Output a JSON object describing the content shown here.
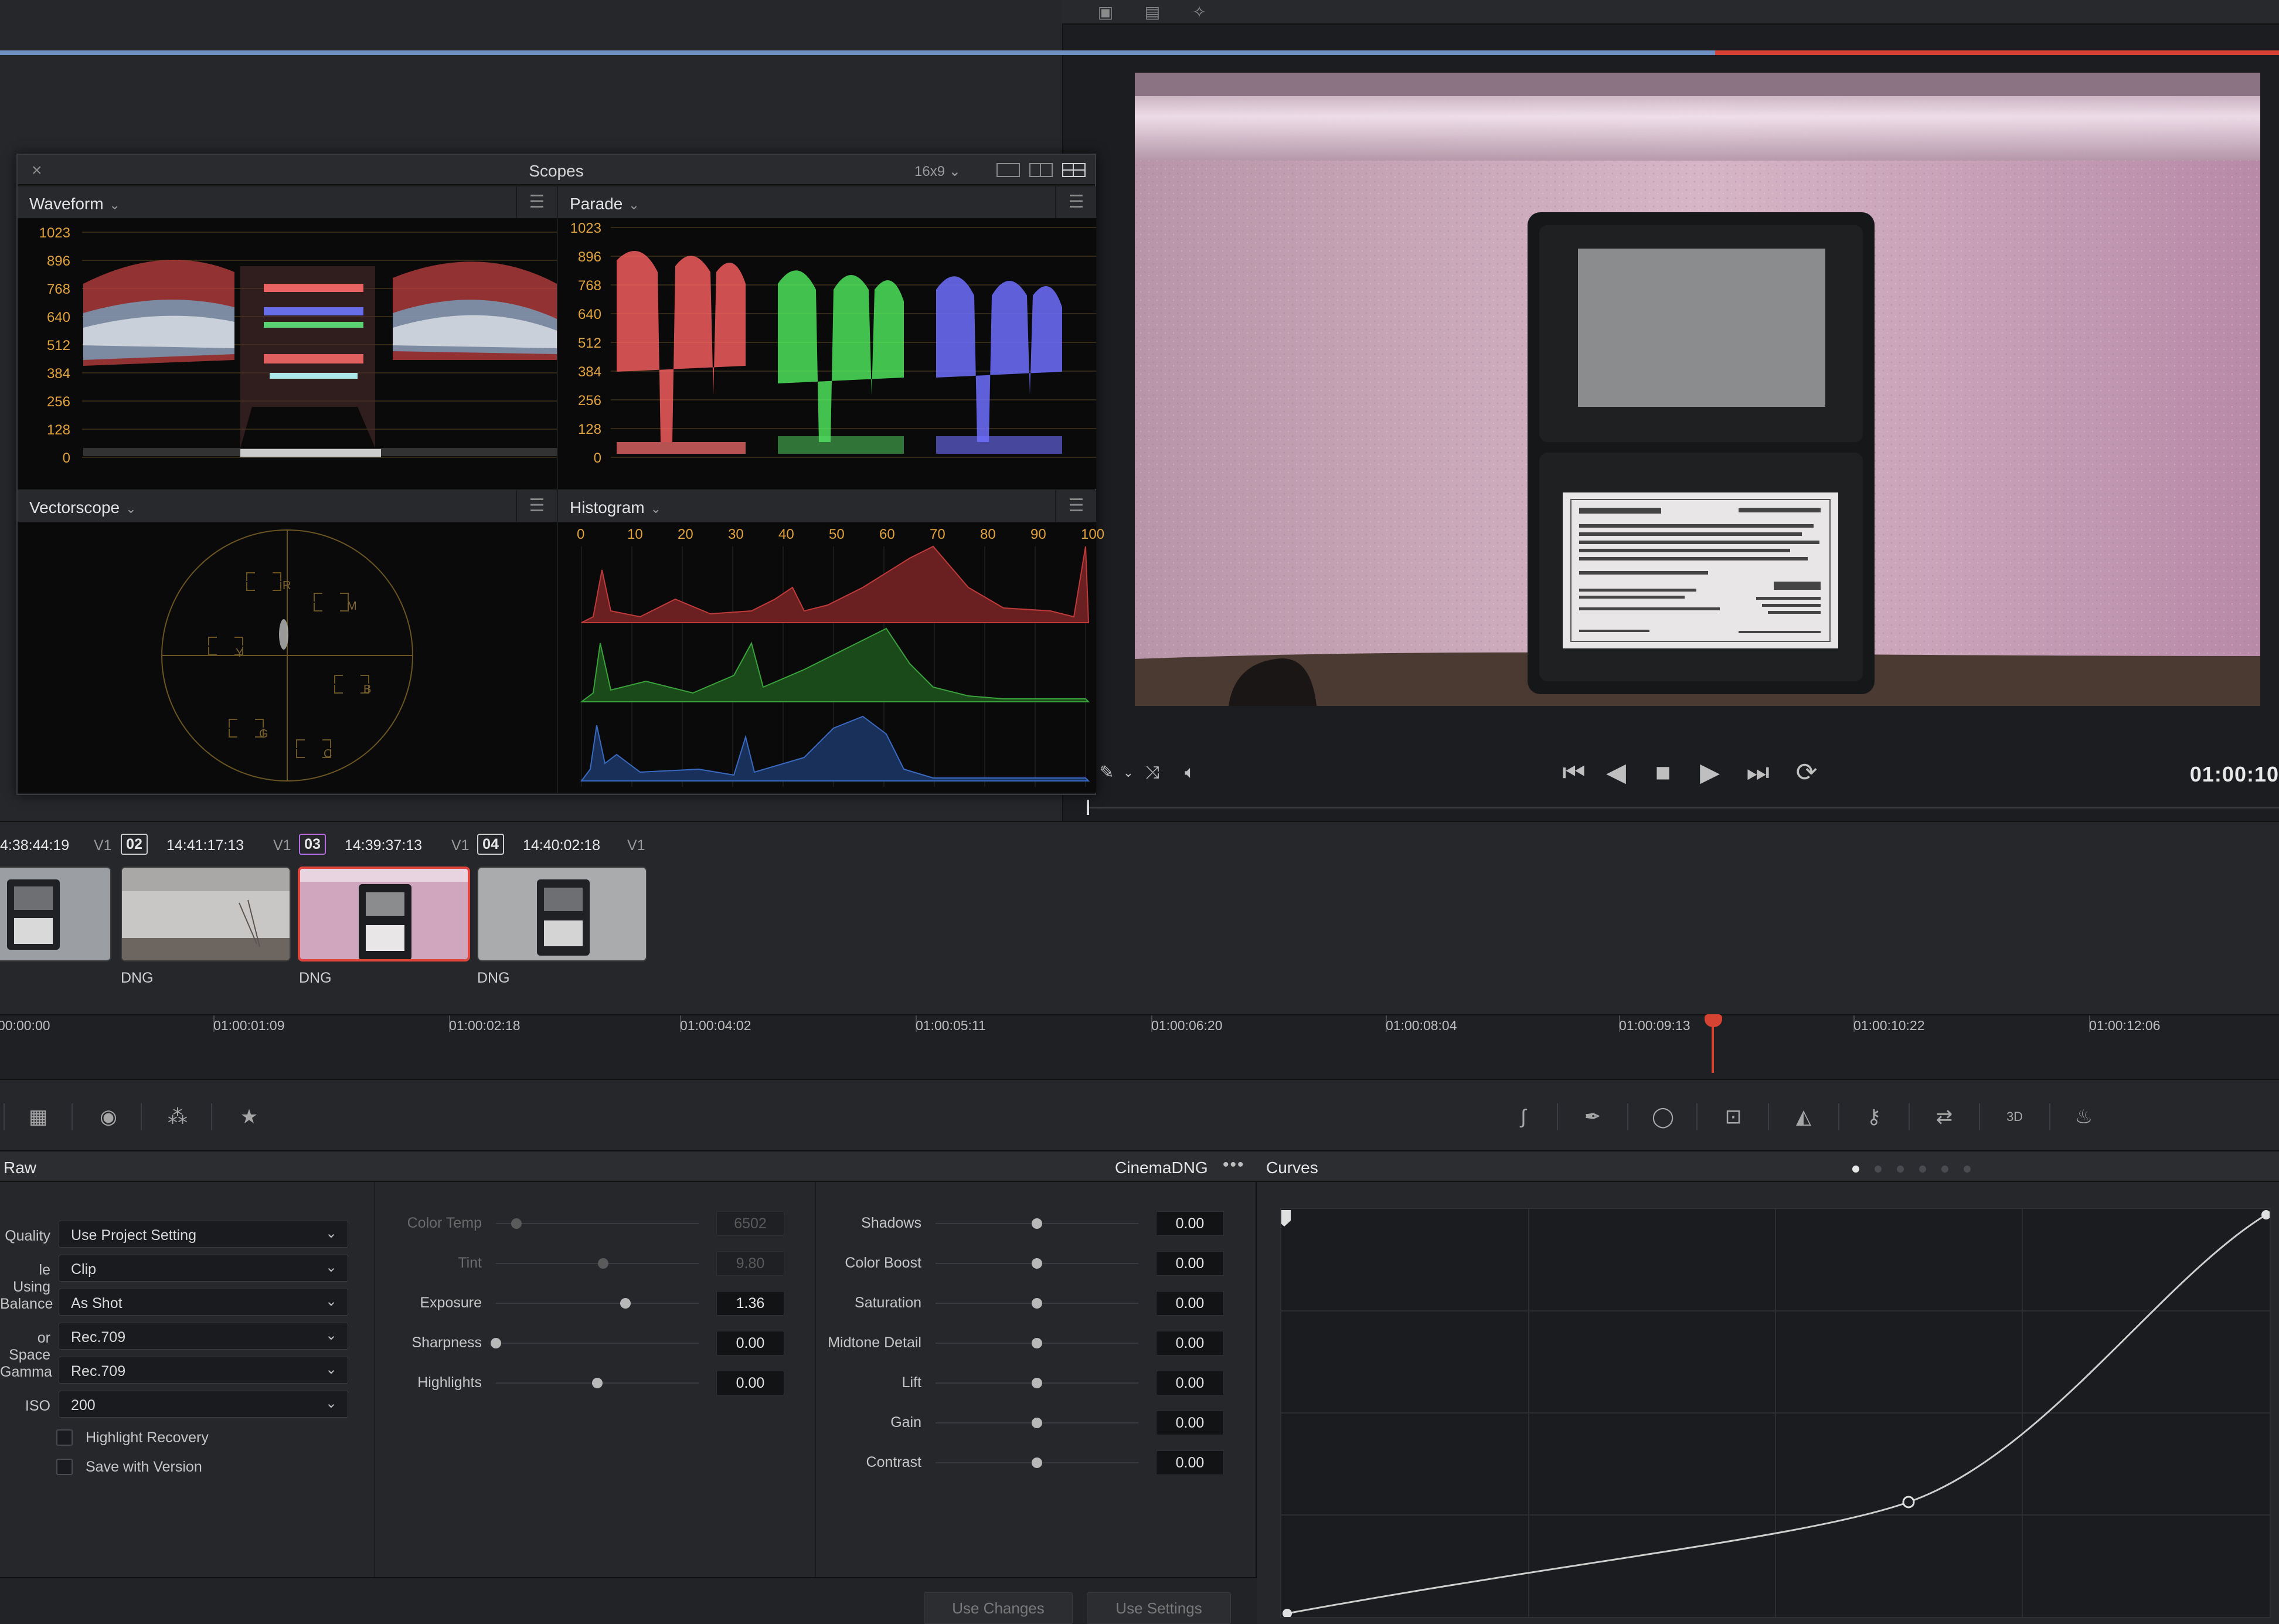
{
  "viewer": {
    "timecode": "01:00:10",
    "toolbar_icons": [
      "single-view-icon",
      "split-view-icon",
      "magic-wand-icon"
    ]
  },
  "scopes": {
    "title": "Scopes",
    "aspect": "16x9",
    "waveform": {
      "name": "Waveform",
      "y_ticks": [
        "1023",
        "896",
        "768",
        "640",
        "512",
        "384",
        "256",
        "128",
        "0"
      ]
    },
    "parade": {
      "name": "Parade",
      "y_ticks": [
        "1023",
        "896",
        "768",
        "640",
        "512",
        "384",
        "256",
        "128",
        "0"
      ]
    },
    "vectorscope": {
      "name": "Vectorscope",
      "targets": [
        "R",
        "M",
        "Y",
        "B",
        "G",
        "C"
      ]
    },
    "histogram": {
      "name": "Histogram",
      "x_ticks": [
        "0",
        "10",
        "20",
        "30",
        "40",
        "50",
        "60",
        "70",
        "80",
        "90",
        "100"
      ]
    }
  },
  "clips": [
    {
      "timecode": "4:38:44:19",
      "track": "V1",
      "type": ""
    },
    {
      "number": "02",
      "timecode": "14:41:17:13",
      "track": "V1",
      "type": "DNG"
    },
    {
      "number": "03",
      "timecode": "14:39:37:13",
      "track": "V1",
      "type": "DNG"
    },
    {
      "number": "04",
      "timecode": "14:40:02:18",
      "track": "V1",
      "type": "DNG"
    }
  ],
  "timeline": {
    "labels": [
      "00:00:00",
      "01:00:01:09",
      "01:00:02:18",
      "01:00:04:02",
      "01:00:05:11",
      "01:00:06:20",
      "01:00:08:04",
      "01:00:09:13",
      "01:00:10:22",
      "01:00:12:06"
    ]
  },
  "raw": {
    "title": "Raw",
    "format": "CinemaDNG",
    "dots": "•••",
    "fields": [
      {
        "label": "Quality",
        "value": "Use Project Setting"
      },
      {
        "label": "le Using",
        "value": "Clip"
      },
      {
        "label": "Balance",
        "value": "As Shot"
      },
      {
        "label": "or Space",
        "value": "Rec.709"
      },
      {
        "label": "Gamma",
        "value": "Rec.709"
      },
      {
        "label": "ISO",
        "value": "200"
      }
    ],
    "checkboxes": [
      "Highlight Recovery",
      "Save with Version"
    ],
    "mid": [
      {
        "label": "Color Temp",
        "value": "6502",
        "pos": 0.1,
        "dim": true
      },
      {
        "label": "Tint",
        "value": "9.80",
        "pos": 0.53,
        "dim": true
      },
      {
        "label": "Exposure",
        "value": "1.36",
        "pos": 0.64,
        "dim": false
      },
      {
        "label": "Sharpness",
        "value": "0.00",
        "pos": 0.0,
        "dim": false
      },
      {
        "label": "Highlights",
        "value": "0.00",
        "pos": 0.5,
        "dim": false
      }
    ],
    "right": [
      {
        "label": "Shadows",
        "value": "0.00"
      },
      {
        "label": "Color Boost",
        "value": "0.00"
      },
      {
        "label": "Saturation",
        "value": "0.00"
      },
      {
        "label": "Midtone Detail",
        "value": "0.00"
      },
      {
        "label": "Lift",
        "value": "0.00"
      },
      {
        "label": "Gain",
        "value": "0.00"
      },
      {
        "label": "Contrast",
        "value": "0.00"
      }
    ],
    "use_changes": "Use Changes",
    "use_settings": "Use Settings"
  },
  "curves": {
    "title": "Curves"
  }
}
